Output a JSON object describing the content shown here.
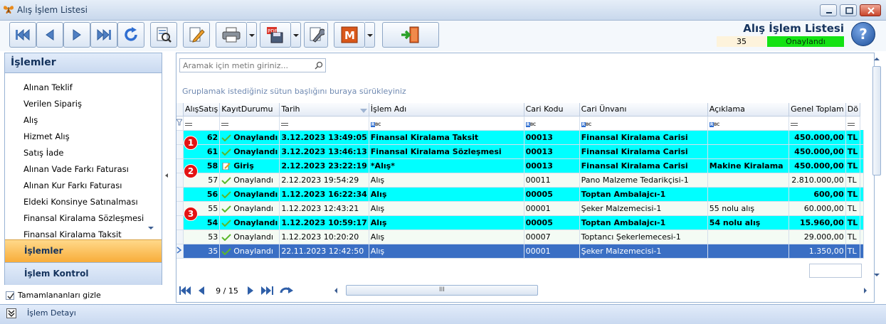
{
  "window": {
    "title": "Alış İşlem Listesi"
  },
  "header": {
    "title": "Alış İşlem Listesi",
    "record_no": "35",
    "status": "Onaylandı"
  },
  "left_panel": {
    "title": "İşlemler",
    "items": [
      "Alınan Teklif",
      "Verilen Sipariş",
      "Alış",
      "Hizmet Alış",
      "Satış İade",
      "Alınan Vade Farkı Faturası",
      "Alınan Kur Farkı Faturası",
      "Eldeki Konsinye Satınalması",
      "Finansal Kiralama Sözleşmesi",
      "Finansal Kiralama Taksit"
    ],
    "sections": [
      "İşlemler",
      "İşlem Kontrol"
    ],
    "hide_completed_label": "Tamamlananları gizle"
  },
  "grid": {
    "search_placeholder": "Aramak için metin giriniz...",
    "group_hint": "Gruplamak istediğiniz sütun başlığını buraya sürükleyiniz",
    "columns": [
      "AlışSatış",
      "KayıtDurumu",
      "Tarih",
      "İşlem Adı",
      "Cari Kodu",
      "Cari Ünvanı",
      "Açıklama",
      "Genel Toplam",
      "Dö"
    ],
    "rows": [
      {
        "no": "62",
        "status": "Onaylandı",
        "date": "3.12.2023 13:49:05",
        "name": "Finansal Kiralama Taksit",
        "code": "00013",
        "cari": "Finansal Kiralama Carisi",
        "desc": "",
        "total": "450.000,00",
        "cur": "TL"
      },
      {
        "no": "61",
        "status": "Onaylandı",
        "date": "3.12.2023 13:46:13",
        "name": "Finansal Kiralama Sözleşmesi",
        "code": "00013",
        "cari": "Finansal Kiralama Carisi",
        "desc": "",
        "total": "450.000,00",
        "cur": "TL"
      },
      {
        "no": "58",
        "status": "Giriş",
        "date": "2.12.2023 23:22:19",
        "name": "*Alış*",
        "code": "00013",
        "cari": "Finansal Kiralama Carisi",
        "desc": "Makine Kiralama",
        "total": "450.000,00",
        "cur": "TL"
      },
      {
        "no": "57",
        "status": "Onaylandı",
        "date": "2.12.2023 19:54:29",
        "name": "Alış",
        "code": "00011",
        "cari": "Pano Malzeme Tedarikçisi-1",
        "desc": "",
        "total": "2.810.000,00",
        "cur": "TL"
      },
      {
        "no": "56",
        "status": "Onaylandı",
        "date": "1.12.2023 16:22:34",
        "name": "Alış",
        "code": "00005",
        "cari": "Toptan Ambalajcı-1",
        "desc": "",
        "total": "600,00",
        "cur": "TL"
      },
      {
        "no": "55",
        "status": "Onaylandı",
        "date": "1.12.2023 12:43:21",
        "name": "Alış",
        "code": "00001",
        "cari": "Şeker Malzemecisi-1",
        "desc": "55 nolu alış",
        "total": "60.000,00",
        "cur": "TL"
      },
      {
        "no": "54",
        "status": "Onaylandı",
        "date": "1.12.2023 10:59:17",
        "name": "Alış",
        "code": "00005",
        "cari": "Toptan Ambalajcı-1",
        "desc": "54 nolu alış",
        "total": "15.960,00",
        "cur": "TL"
      },
      {
        "no": "53",
        "status": "Onaylandı",
        "date": "1.12.2023 10:20:20",
        "name": "Alış",
        "code": "00007",
        "cari": "Toptancı Şekerlemecesi-1",
        "desc": "",
        "total": "29.000,00",
        "cur": "TL"
      },
      {
        "no": "35",
        "status": "Onaylandı",
        "date": "22.11.2023 12:42:50",
        "name": "Alış",
        "code": "00001",
        "cari": "Şeker Malzemecisi-1",
        "desc": "",
        "total": "1.350,00",
        "cur": "TL"
      }
    ],
    "markers": [
      "1",
      "2",
      "3"
    ],
    "page_info": "9 / 15",
    "scroll_grip": "III"
  },
  "bottom": {
    "label": "İşlem Detayı"
  },
  "colors": {
    "cyan_row": "#00ffff",
    "light_row": "#f4fbf4",
    "selected_row": "#3a6fc4",
    "ok_green": "#14e214"
  }
}
